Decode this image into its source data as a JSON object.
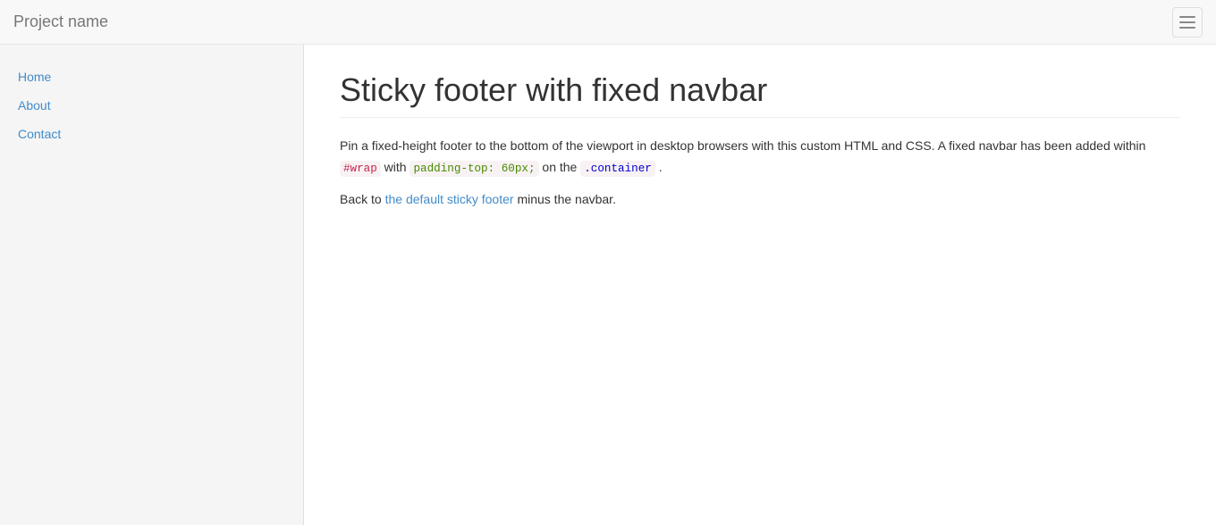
{
  "navbar": {
    "brand": "Project name",
    "toggle_label": "Toggle navigation"
  },
  "sidebar": {
    "nav_items": [
      {
        "label": "Home",
        "href": "#"
      },
      {
        "label": "About",
        "href": "#"
      },
      {
        "label": "Contact",
        "href": "#"
      }
    ]
  },
  "main": {
    "heading": "Sticky footer with fixed navbar",
    "description_part1": "Pin a fixed-height footer to the bottom of the viewport in desktop browsers with this custom HTML and CSS. A fixed navbar has been added within ",
    "code_wrap": "#wrap",
    "description_part2": " with ",
    "code_padding": "padding-top: 60px;",
    "description_part3": " on the ",
    "code_container": ".container",
    "description_part4": " .",
    "back_text_prefix": "Back to ",
    "back_link_label": "the default sticky footer",
    "back_text_suffix": " minus the navbar."
  }
}
